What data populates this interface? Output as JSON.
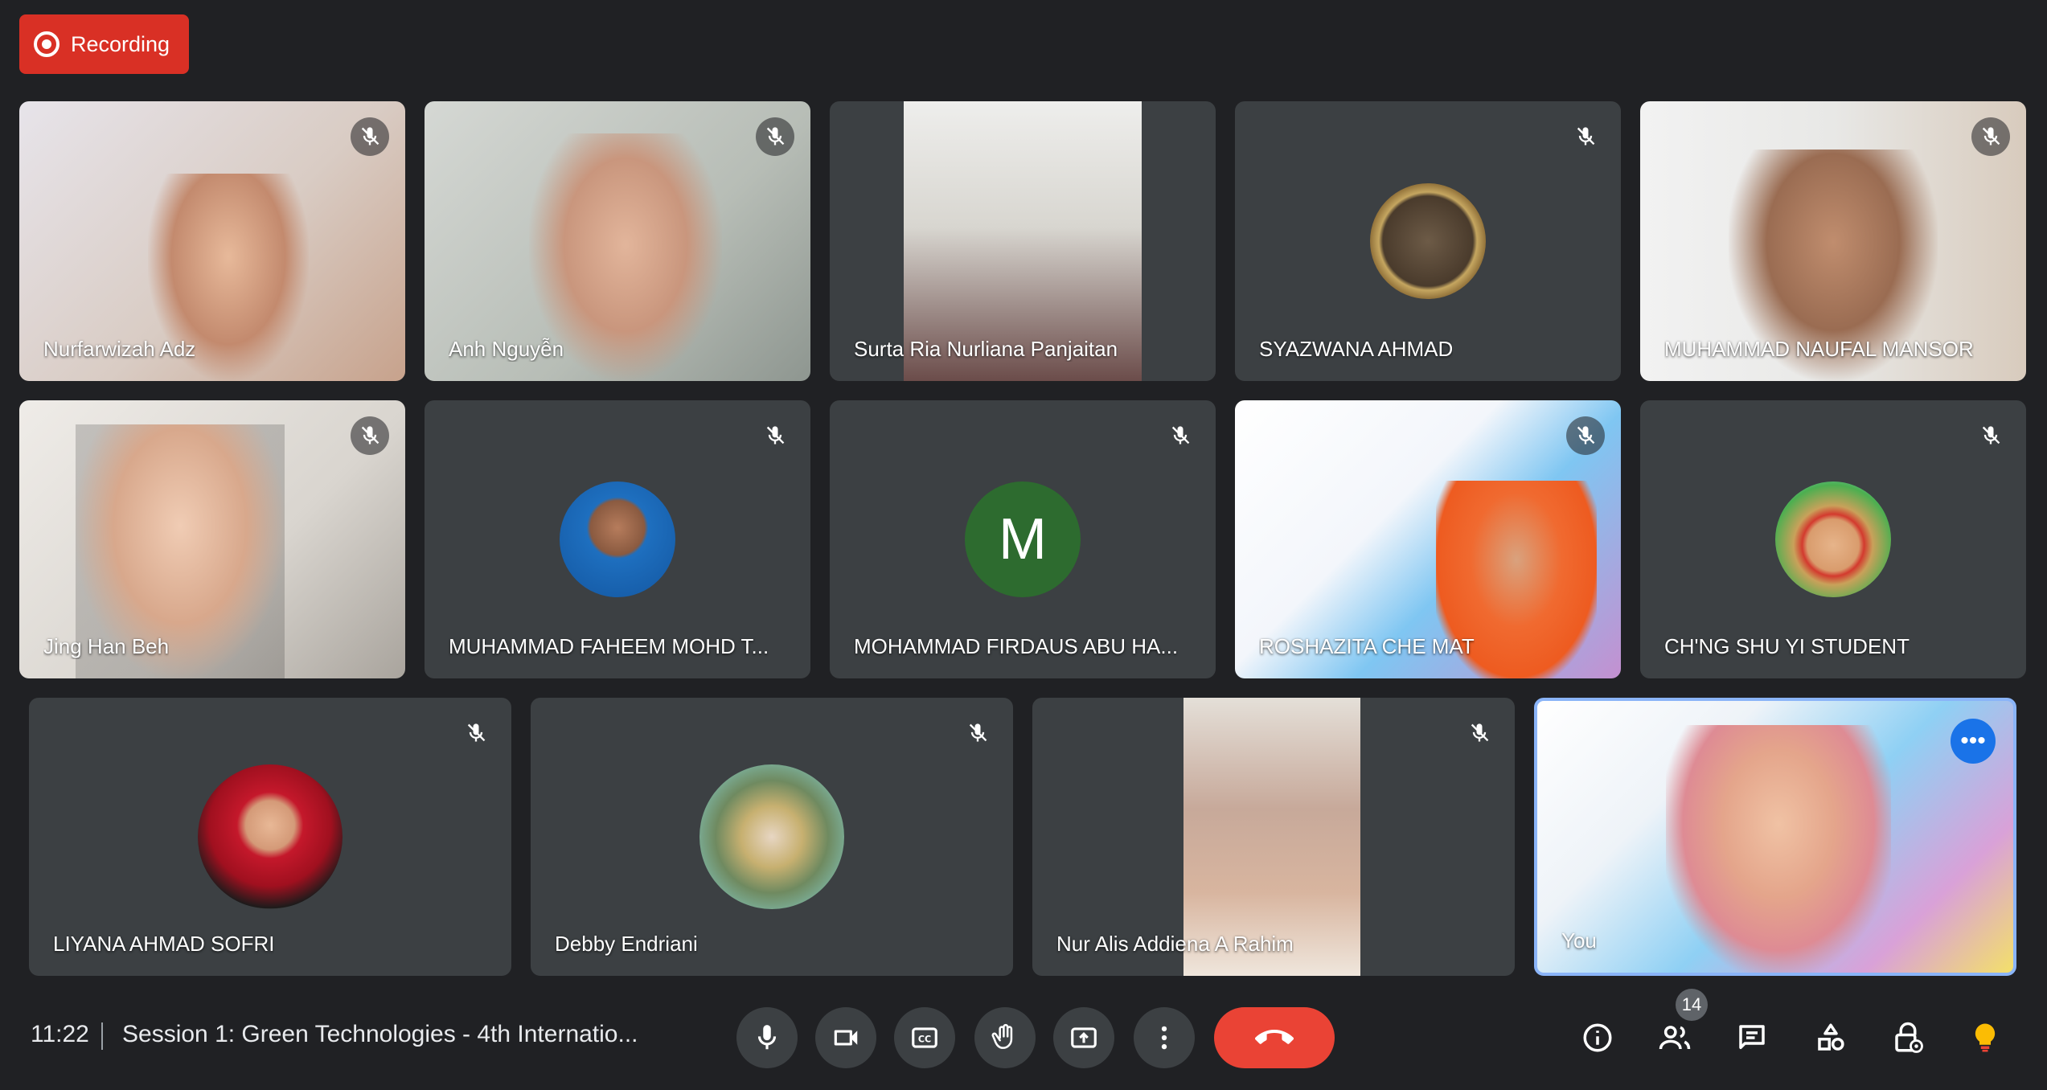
{
  "recording": {
    "label": "Recording"
  },
  "participants": [
    {
      "name": "Nurfarwizah Adz"
    },
    {
      "name": "Anh Nguyễn"
    },
    {
      "name": "Surta Ria Nurliana Panjaitan"
    },
    {
      "name": "SYAZWANA AHMAD"
    },
    {
      "name": "MUHAMMAD NAUFAL MANSOR"
    },
    {
      "name": "Jing Han Beh"
    },
    {
      "name": "MUHAMMAD FAHEEM MOHD T..."
    },
    {
      "name": "MOHAMMAD FIRDAUS ABU HA...",
      "initial": "M"
    },
    {
      "name": "ROSHAZITA CHE MAT"
    },
    {
      "name": "CH'NG SHU YI STUDENT"
    },
    {
      "name": "LIYANA AHMAD SOFRI"
    },
    {
      "name": "Debby Endriani"
    },
    {
      "name": "Nur Alis Addiena A Rahim"
    },
    {
      "name": "You"
    }
  ],
  "bottom_bar": {
    "time": "11:22",
    "meeting_title": "Session 1: Green Technologies - 4th Internatio...",
    "people_count": "14"
  },
  "colors": {
    "background": "#202124",
    "tile": "#3c4043",
    "recording": "#d93025",
    "end_call": "#ea4335",
    "self_border": "#8ab4f8",
    "avatar_green": "#2d6b2f"
  },
  "icons": {
    "mute": "mic-off-icon",
    "controls": [
      "mic-icon",
      "camera-icon",
      "captions-icon",
      "raise-hand-icon",
      "present-icon",
      "more-options-icon",
      "end-call-icon"
    ],
    "right": [
      "info-icon",
      "people-icon",
      "chat-icon",
      "activities-icon",
      "host-controls-icon",
      "light-bulb-icon"
    ]
  }
}
